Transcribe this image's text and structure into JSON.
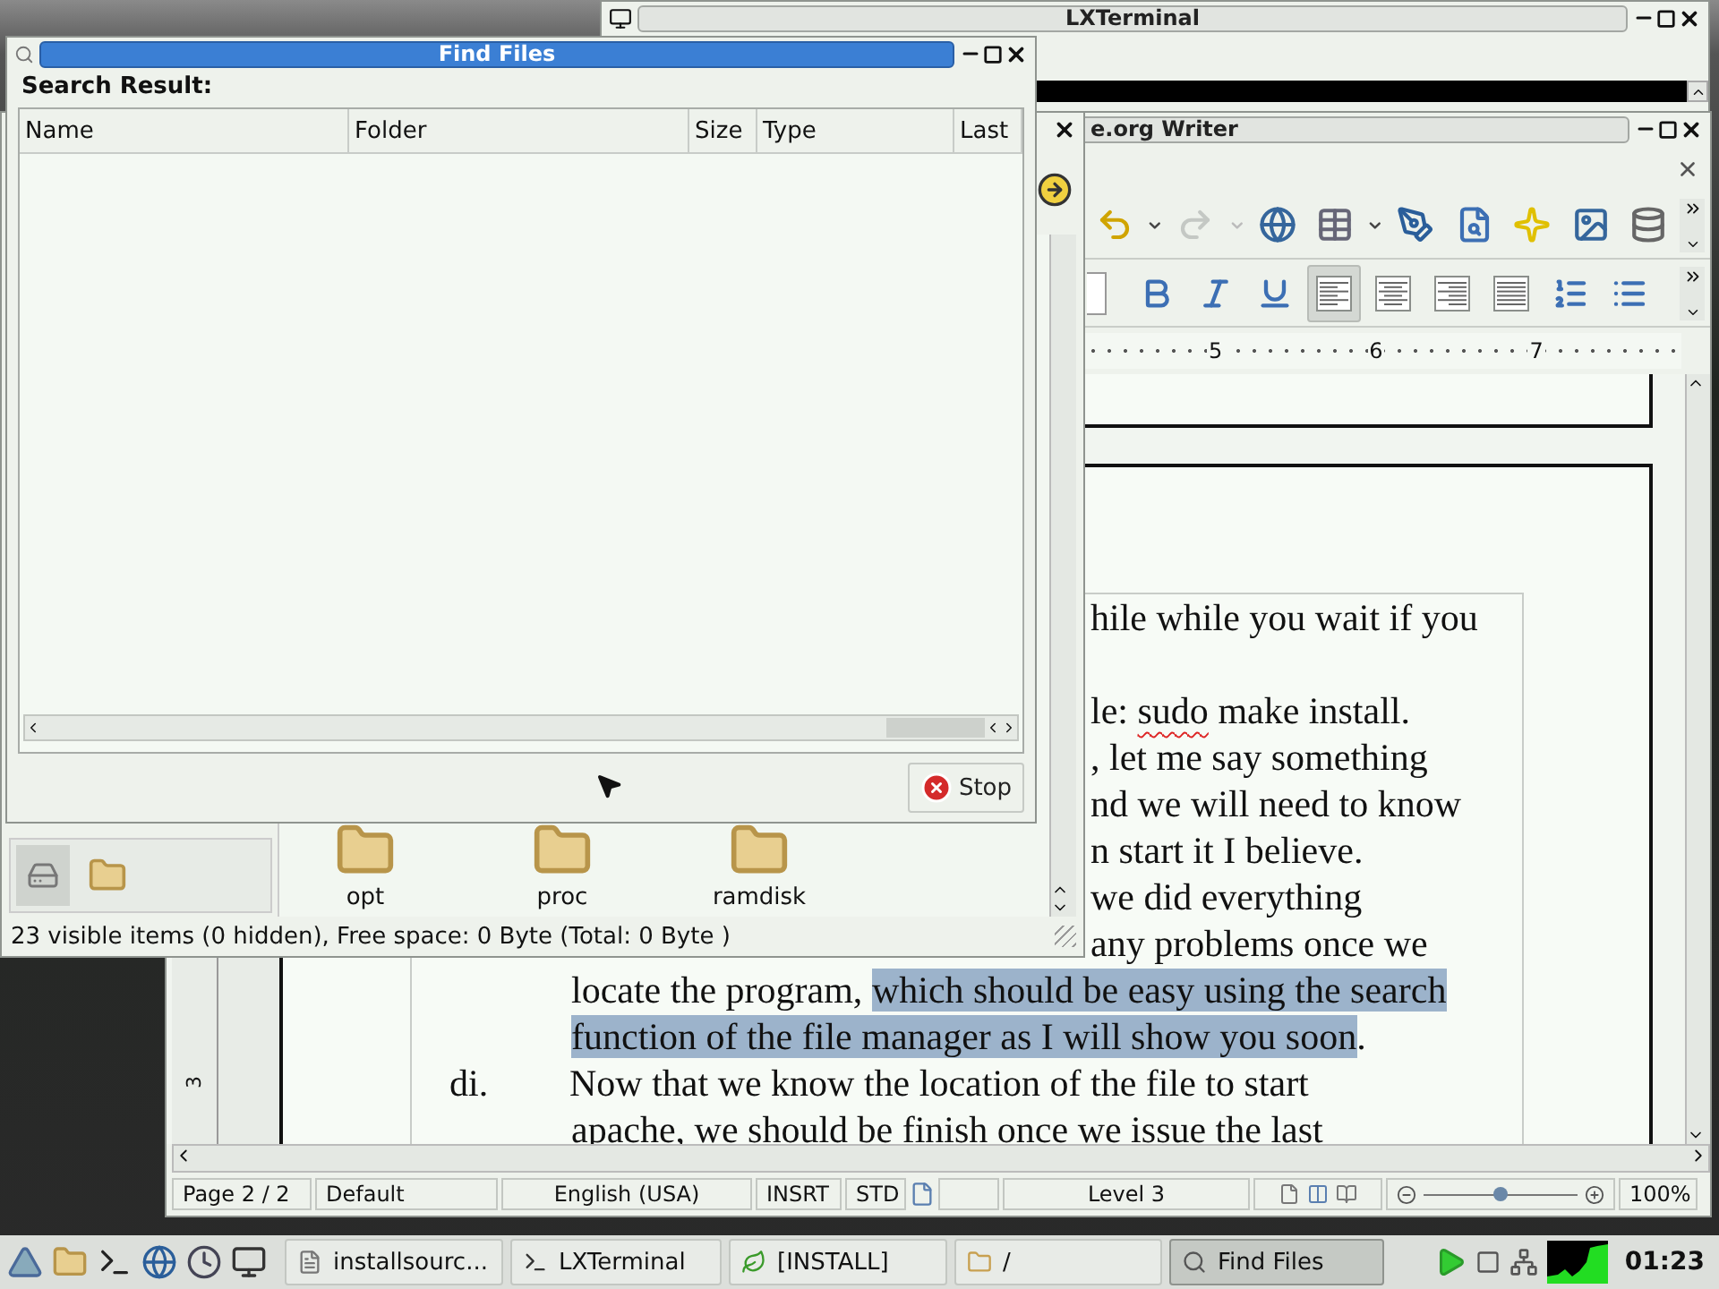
{
  "terminal": {
    "title": "LXTerminal"
  },
  "writer": {
    "title": "e.org Writer",
    "toolbar": [
      {
        "kind": "undo",
        "disabled": false
      },
      {
        "kind": "redo",
        "disabled": true
      },
      {
        "kind": "globe",
        "disabled": false
      },
      {
        "kind": "table",
        "disabled": false
      },
      {
        "kind": "pen",
        "disabled": false
      },
      {
        "kind": "find",
        "disabled": false
      },
      {
        "kind": "star",
        "disabled": false
      },
      {
        "kind": "image",
        "disabled": false
      },
      {
        "kind": "database",
        "disabled": false
      }
    ],
    "format_bar": [
      {
        "kind": "bold",
        "selected": false
      },
      {
        "kind": "italic",
        "selected": false
      },
      {
        "kind": "underline",
        "selected": false
      },
      {
        "kind": "align-left",
        "selected": true
      },
      {
        "kind": "align-center",
        "selected": false
      },
      {
        "kind": "align-right",
        "selected": false
      },
      {
        "kind": "justify",
        "selected": false
      },
      {
        "kind": "numbering",
        "selected": false
      },
      {
        "kind": "bullets",
        "selected": false
      }
    ],
    "ruler_labels": [
      "5",
      "6",
      "7"
    ],
    "vertical_ruler_label": "3",
    "lines": [
      {
        "kind": "clipped",
        "space_before": false,
        "segments": [
          {
            "text": "hile while you wait if you",
            "selected": false,
            "misspelled": false
          }
        ]
      },
      {
        "kind": "clipped",
        "space_before": true,
        "segments": [
          {
            "text": "le: ",
            "selected": false,
            "misspelled": false
          },
          {
            "text": "sudo",
            "selected": false,
            "misspelled": true
          },
          {
            "text": " make install.",
            "selected": false,
            "misspelled": false
          }
        ]
      },
      {
        "kind": "clipped",
        "space_before": false,
        "segments": [
          {
            "text": ", let me say something",
            "selected": false,
            "misspelled": false
          }
        ]
      },
      {
        "kind": "clipped",
        "space_before": false,
        "segments": [
          {
            "text": "nd we will need to know",
            "selected": false,
            "misspelled": false
          }
        ]
      },
      {
        "kind": "clipped",
        "space_before": false,
        "segments": [
          {
            "text": "n start it I believe.",
            "selected": false,
            "misspelled": false
          }
        ]
      },
      {
        "kind": "clipped",
        "space_before": false,
        "segments": [
          {
            "text": "we did everything",
            "selected": false,
            "misspelled": false
          }
        ]
      },
      {
        "kind": "clipped",
        "space_before": false,
        "segments": [
          {
            "text": "any problems once we",
            "selected": false,
            "misspelled": false
          }
        ]
      },
      {
        "kind": "body",
        "space_before": false,
        "segments": [
          {
            "text": "locate the program, ",
            "selected": false,
            "misspelled": false
          },
          {
            "text": "which should be easy using the search",
            "selected": true,
            "misspelled": false
          }
        ]
      },
      {
        "kind": "body",
        "space_before": false,
        "segments": [
          {
            "text": "function of the file manager as I will show you soon",
            "selected": true,
            "misspelled": false
          },
          {
            "text": ".",
            "selected": false,
            "misspelled": false
          }
        ]
      },
      {
        "kind": "numbered",
        "number": "di.",
        "space_before": false,
        "segments": [
          {
            "text": "Now that we know the location of the file to start",
            "selected": false,
            "misspelled": false
          }
        ]
      },
      {
        "kind": "body",
        "space_before": false,
        "segments": [
          {
            "text": "apache, we should be finish once we issue the last",
            "selected": false,
            "misspelled": false
          }
        ]
      }
    ],
    "status_bar": {
      "page": "Page 2 / 2",
      "page_style": "Default",
      "language": "English (USA)",
      "insert_mode": "INSRT",
      "selection_mode": "STD",
      "outline_level": "Level 3",
      "zoom": {
        "level": 0.5,
        "reading": "100%"
      }
    }
  },
  "file_manager": {
    "folders": [
      "opt",
      "proc",
      "ramdisk"
    ],
    "status": "23 visible items (0 hidden), Free space: 0 Byte (Total: 0 Byte )"
  },
  "find_files": {
    "title": "Find Files",
    "heading": "Search Result:",
    "columns": [
      "Name",
      "Folder",
      "Size",
      "Type",
      "Last"
    ],
    "stop_label": "Stop"
  },
  "taskbar": {
    "tasks": [
      {
        "kind": "document",
        "label": "installsourc...",
        "selected": false
      },
      {
        "kind": "terminal",
        "label": "LXTerminal",
        "selected": false
      },
      {
        "kind": "leaf",
        "label": "[INSTALL]",
        "selected": false
      },
      {
        "kind": "folder",
        "label": "/",
        "selected": false
      },
      {
        "kind": "search",
        "label": "Find Files",
        "selected": true
      }
    ],
    "clock": "01:23"
  }
}
